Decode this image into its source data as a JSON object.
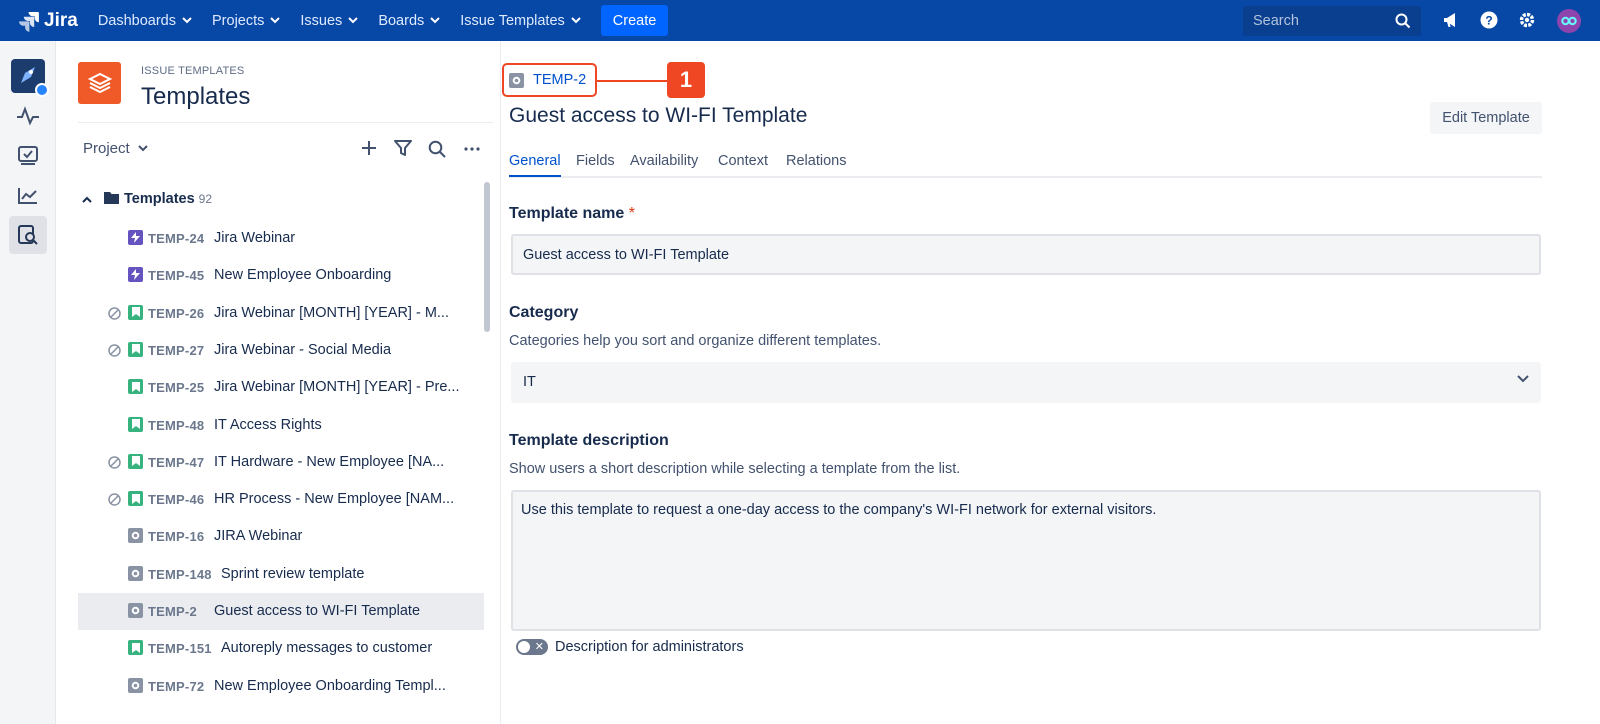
{
  "topnav": {
    "logo_text": "Jira",
    "items": [
      {
        "label": "Dashboards"
      },
      {
        "label": "Projects"
      },
      {
        "label": "Issues"
      },
      {
        "label": "Boards"
      },
      {
        "label": "Issue Templates"
      }
    ],
    "create_label": "Create",
    "search_placeholder": "Search",
    "brand_color": "#0747a6"
  },
  "panel": {
    "eyebrow": "ISSUE TEMPLATES",
    "title": "Templates",
    "project_selector": "Project",
    "tree": {
      "root_label": "Templates",
      "root_count": "92",
      "items": [
        {
          "key": "TEMP-24",
          "label": "Jira Webinar",
          "icon": "lightning-icon",
          "blocked": false,
          "selected": false
        },
        {
          "key": "TEMP-45",
          "label": "New Employee Onboarding",
          "icon": "lightning-icon",
          "blocked": false,
          "selected": false
        },
        {
          "key": "TEMP-26",
          "label": "Jira Webinar [MONTH] [YEAR] - M...",
          "icon": "bookmark-icon",
          "blocked": true,
          "selected": false
        },
        {
          "key": "TEMP-27",
          "label": "Jira Webinar - Social Media",
          "icon": "bookmark-icon",
          "blocked": true,
          "selected": false
        },
        {
          "key": "TEMP-25",
          "label": "Jira Webinar [MONTH] [YEAR] - Pre...",
          "icon": "bookmark-icon",
          "blocked": false,
          "selected": false
        },
        {
          "key": "TEMP-48",
          "label": "IT Access Rights",
          "icon": "bookmark-icon",
          "blocked": false,
          "selected": false
        },
        {
          "key": "TEMP-47",
          "label": "IT Hardware - New Employee [NA...",
          "icon": "bookmark-icon",
          "blocked": true,
          "selected": false
        },
        {
          "key": "TEMP-46",
          "label": "HR Process - New Employee [NAM...",
          "icon": "bookmark-icon",
          "blocked": true,
          "selected": false
        },
        {
          "key": "TEMP-16",
          "label": "JIRA Webinar",
          "icon": "task-icon",
          "blocked": false,
          "selected": false
        },
        {
          "key": "TEMP-148",
          "label": "Sprint review template",
          "icon": "task-icon",
          "blocked": false,
          "selected": false
        },
        {
          "key": "TEMP-2",
          "label": "Guest access to WI-FI Template",
          "icon": "task-icon",
          "blocked": false,
          "selected": true
        },
        {
          "key": "TEMP-151",
          "label": "Autoreply messages to customer",
          "icon": "bookmark-icon",
          "blocked": false,
          "selected": false
        },
        {
          "key": "TEMP-72",
          "label": "New Employee Onboarding Templ...",
          "icon": "task-icon",
          "blocked": false,
          "selected": false
        }
      ]
    }
  },
  "main": {
    "issue_key": "TEMP-2",
    "callout_number": "1",
    "title": "Guest access to WI-FI Template",
    "edit_label": "Edit Template",
    "tabs": [
      {
        "label": "General",
        "active": true
      },
      {
        "label": "Fields",
        "active": false
      },
      {
        "label": "Availability",
        "active": false
      },
      {
        "label": "Context",
        "active": false
      },
      {
        "label": "Relations",
        "active": false
      }
    ],
    "template_name": {
      "label": "Template name",
      "required_mark": "*",
      "value": "Guest access to WI-FI Template"
    },
    "category": {
      "label": "Category",
      "help": "Categories help you sort and organize different templates.",
      "value": "IT"
    },
    "description": {
      "label": "Template description",
      "help": "Show users a short description while selecting a template from the list.",
      "value": "Use this template to request a one-day access to the company's WI-FI network for external visitors."
    },
    "admin_toggle": {
      "label": "Description for administrators",
      "on": false
    }
  }
}
